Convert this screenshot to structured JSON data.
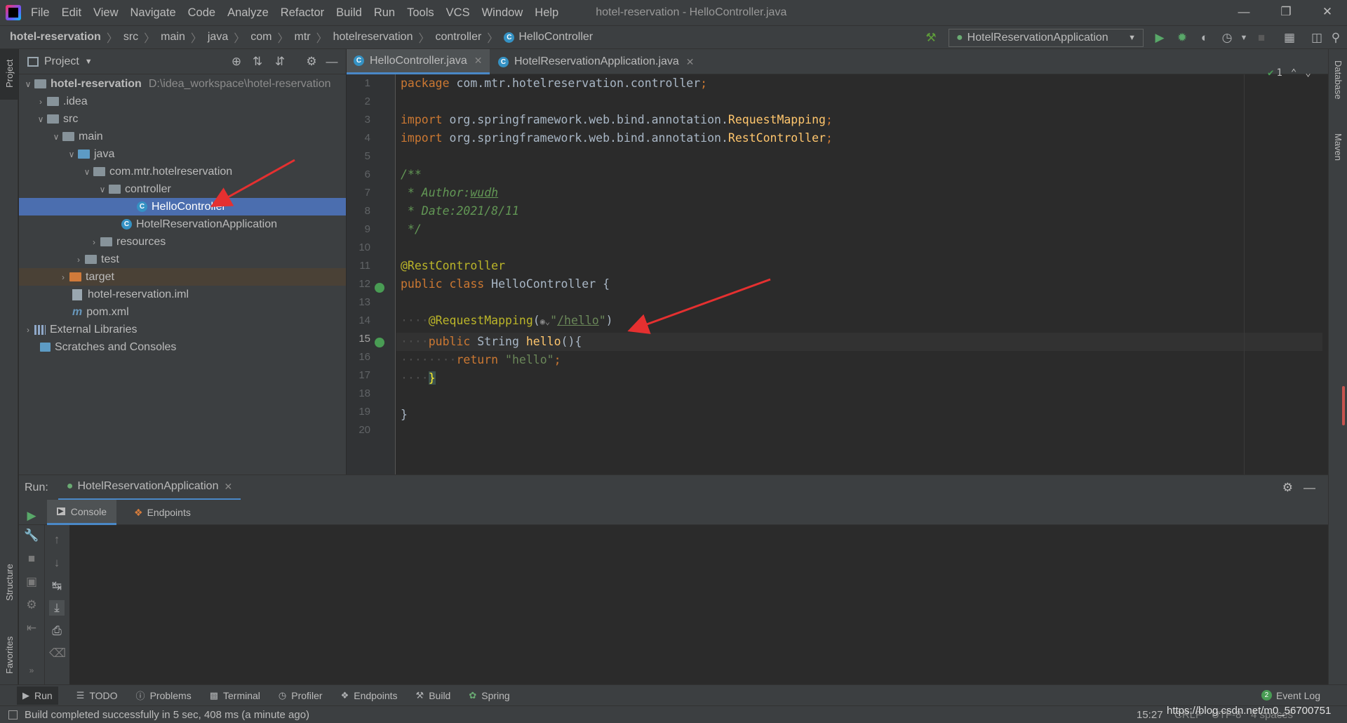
{
  "menubar": {
    "items": [
      "File",
      "Edit",
      "View",
      "Navigate",
      "Code",
      "Analyze",
      "Refactor",
      "Build",
      "Run",
      "Tools",
      "VCS",
      "Window",
      "Help"
    ],
    "title": "hotel-reservation - HelloController.java"
  },
  "breadcrumb": [
    "hotel-reservation",
    "src",
    "main",
    "java",
    "com",
    "mtr",
    "hotelreservation",
    "controller",
    "HelloController"
  ],
  "run_config": "HotelReservationApplication",
  "project_panel": {
    "title": "Project",
    "root_name": "hotel-reservation",
    "root_path": "D:\\idea_workspace\\hotel-reservation",
    "items": [
      ".idea",
      "src",
      "main",
      "java",
      "com.mtr.hotelreservation",
      "controller",
      "HelloController",
      "HotelReservationApplication",
      "resources",
      "test",
      "target",
      "hotel-reservation.iml",
      "pom.xml",
      "External Libraries",
      "Scratches and Consoles"
    ]
  },
  "editor": {
    "tabs": [
      "HelloController.java",
      "HotelReservationApplication.java"
    ],
    "line_numbers": [
      "1",
      "2",
      "3",
      "4",
      "5",
      "6",
      "7",
      "8",
      "9",
      "10",
      "11",
      "12",
      "13",
      "14",
      "15",
      "16",
      "17",
      "18",
      "19",
      "20"
    ],
    "inspection_count": "1",
    "code": {
      "l1_kw": "package",
      "l1_rest": " com.mtr.hotelreservation.controller",
      "l1_semi": ";",
      "l3_kw": "import",
      "l3_pkg": " org.springframework.web.bind.annotation.",
      "l3_ann": "RequestMapping",
      "l4_kw": "import",
      "l4_pkg": " org.springframework.web.bind.annotation.",
      "l4_ann": "RestController",
      "l6": "/**",
      "l7_pre": " * Author:",
      "l7_val": "wudh",
      "l8": " * Date:2021/8/11",
      "l9": " */",
      "l11": "@RestController",
      "l12_kw": "public class",
      "l12_rest": " HelloController {",
      "l14_ann": "@RequestMapping",
      "l14_open": "(",
      "l14_url": "/hello",
      "l14_close": ")",
      "l15_kw": "public",
      "l15_type": " String ",
      "l15_fn": "hello",
      "l15_rest": "(){",
      "l16_kw": "return",
      "l16_str": "\"hello\"",
      "l16_semi": ";",
      "l17": "}",
      "l19": "}"
    }
  },
  "run_panel": {
    "label": "Run:",
    "tab": "HotelReservationApplication",
    "subtabs": [
      "Console",
      "Endpoints"
    ]
  },
  "left_stripe": [
    "Project",
    "Structure",
    "Favorites"
  ],
  "right_stripe": [
    "Database",
    "Maven"
  ],
  "bottom_tools": [
    "Run",
    "TODO",
    "Problems",
    "Terminal",
    "Profiler",
    "Endpoints",
    "Build",
    "Spring"
  ],
  "event_log": {
    "count": "2",
    "label": "Event Log"
  },
  "status": {
    "message": "Build completed successfully in 5 sec, 408 ms (a minute ago)",
    "position": "15:27",
    "line_sep": "CRLF",
    "encoding": "UTF-8",
    "indent": "4 spaces",
    "watermark": "https://blog.csdn.net/m0_56700751"
  }
}
